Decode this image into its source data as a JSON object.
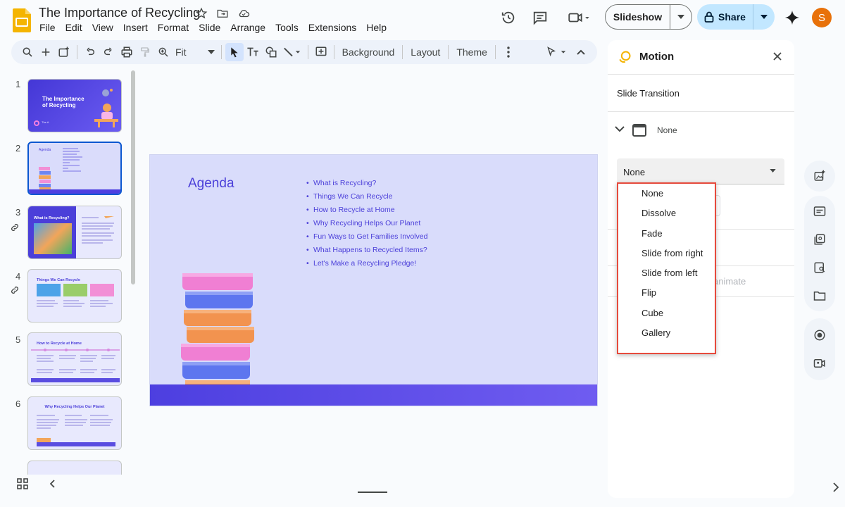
{
  "app": {
    "doc_title": "The Importance of Recycling",
    "menus": [
      "File",
      "Edit",
      "View",
      "Insert",
      "Format",
      "Slide",
      "Arrange",
      "Tools",
      "Extensions",
      "Help"
    ],
    "slideshow_label": "Slideshow",
    "share_label": "Share",
    "avatar_letter": "S",
    "accent": "#0b57d0"
  },
  "toolbar": {
    "zoom": "Fit",
    "background": "Background",
    "layout": "Layout",
    "theme": "Theme"
  },
  "filmstrip": {
    "numbers": [
      "1",
      "2",
      "3",
      "4",
      "5",
      "6"
    ],
    "thumbs": [
      {
        "title": "The Importance of Recycling",
        "sub": "The A"
      },
      {
        "title": "Agenda"
      },
      {
        "title": "What is Recycling?"
      },
      {
        "title": "Things We Can Recycle"
      },
      {
        "title": "How to Recycle at Home"
      },
      {
        "title": "Why Recycling Helps Our Planet"
      }
    ]
  },
  "slide": {
    "title": "Agenda",
    "items": [
      "What is Recycling?",
      "Things We Can Recycle",
      "How to Recycle at Home",
      "Why Recycling Helps Our Planet",
      "Fun Ways to Get Families Involved",
      "What Happens to Recycled Items?",
      "Let's Make a Recycling Pledge!"
    ]
  },
  "motion_panel": {
    "title": "Motion",
    "section": "Slide Transition",
    "current_transition": "None",
    "dropdown_value": "None",
    "hidden_button_text": "animate",
    "options": [
      "None",
      "Dissolve",
      "Fade",
      "Slide from right",
      "Slide from left",
      "Flip",
      "Cube",
      "Gallery"
    ]
  }
}
